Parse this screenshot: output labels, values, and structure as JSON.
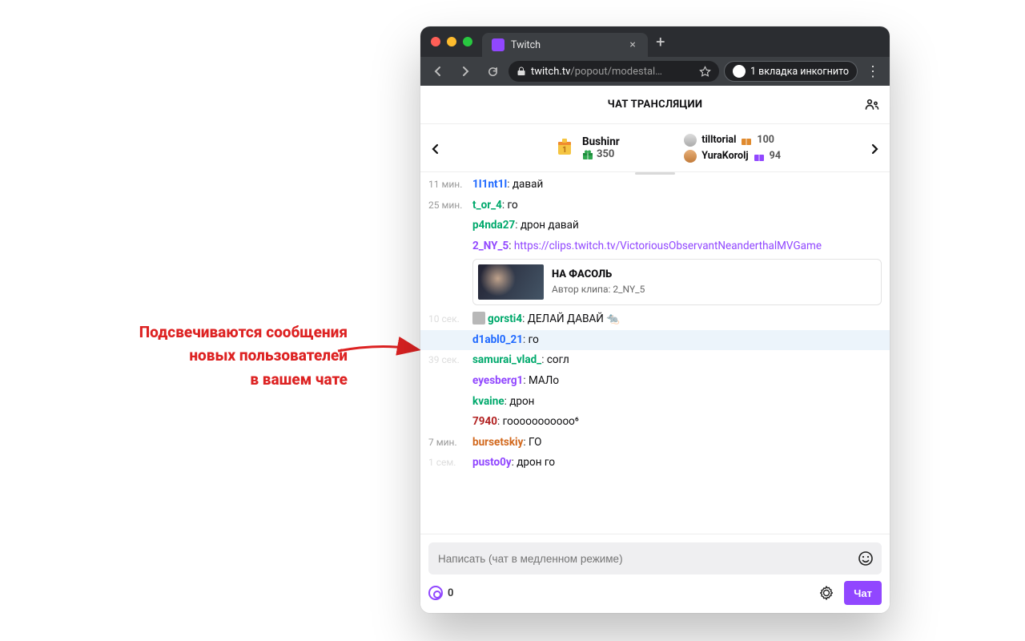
{
  "annotation": {
    "line1": "Подсвечиваются сообщения",
    "line2": "новых пользователей",
    "line3": "в вашем чате"
  },
  "browser": {
    "tab_title": "Twitch",
    "url_domain": "twitch.tv",
    "url_path": "/popout/modestal…",
    "incognito_label": "1 вкладка инкогнито"
  },
  "chat": {
    "title": "ЧАТ ТРАНСЛЯЦИИ",
    "leaderboard": {
      "first": {
        "name": "Bushinr",
        "value": "350"
      },
      "second": {
        "name": "tilltorial",
        "value": "100"
      },
      "third": {
        "name": "YuraKorolj",
        "value": "94"
      }
    },
    "messages": [
      {
        "ts": "11 мин.",
        "user": "1I1nt1I",
        "color": "c-blue",
        "text": "давай"
      },
      {
        "ts": "25 мин.",
        "user": "t_or_4",
        "color": "c-green",
        "text": "го"
      },
      {
        "ts": "",
        "user": "p4nda27",
        "color": "c-green",
        "text": "дрон давай"
      },
      {
        "ts": "",
        "user": "2_NY_5",
        "color": "c-purple",
        "is_link": true,
        "text": "https://clips.twitch.tv/VictoriousObservantNeanderthalMVGame",
        "clip": {
          "title": "НА ФАСОЛЬ",
          "author": "Автор клипа: 2_NY_5"
        }
      },
      {
        "ts": "10 сек.",
        "ts_faint": true,
        "user": "gorsti4",
        "badge": true,
        "color": "c-green",
        "text": "ДЕЛАЙ ДАВАЙ",
        "emote": "🐀"
      },
      {
        "ts": "",
        "user": "d1abl0_21",
        "color": "c-blue",
        "text": "го",
        "highlight": true
      },
      {
        "ts": "39 сек.",
        "ts_faint": true,
        "user": "samurai_vlad_",
        "color": "c-green",
        "text": "согл"
      },
      {
        "ts": "",
        "user": "eyesberg1",
        "color": "c-purple",
        "text": "МАЛо"
      },
      {
        "ts": "",
        "user": "kvaine",
        "color": "c-green",
        "text": "дрон"
      },
      {
        "ts": "",
        "user": "7940",
        "color": "c-crimson",
        "text": "гооооооооооо⁶"
      },
      {
        "ts": "7 мин.",
        "user": "bursetskiy",
        "color": "c-orange",
        "text": "ГО"
      },
      {
        "ts": "1 сем.",
        "ts_faint": true,
        "user": "pusto0y",
        "color": "c-purple",
        "text": "дрон го"
      }
    ],
    "input_placeholder": "Написать (чат в медленном режиме)",
    "points_value": "0",
    "send_label": "Чат"
  }
}
